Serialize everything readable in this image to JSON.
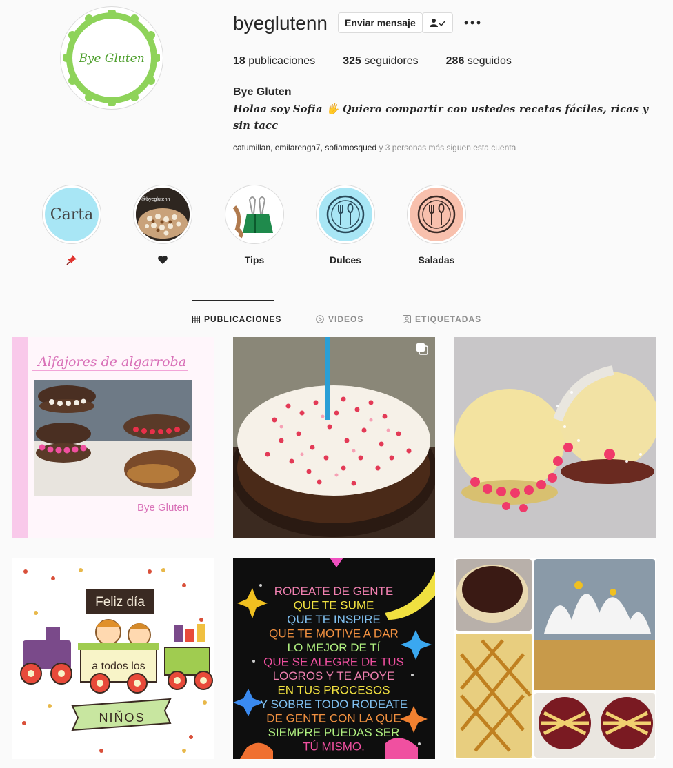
{
  "profile": {
    "username": "byeglutenn",
    "avatar_text": "Bye Gluten",
    "message_button": "Enviar mensaje",
    "follow_icon": "person-check-icon",
    "more_icon": "more-dots-icon",
    "stats": {
      "posts_count": "18",
      "posts_label": "publicaciones",
      "followers_count": "325",
      "followers_label": "seguidores",
      "following_count": "286",
      "following_label": "seguidos"
    },
    "full_name": "Bye Gluten",
    "bio": "Holaa soy Sofia 🖐 Quiero compartir con ustedes recetas fáciles, ricas y sin tacc",
    "followed_by_names": "catumillan, emilarenga7, sofiamosqued",
    "followed_by_more": " y 3 personas más siguen esta cuenta"
  },
  "highlights": [
    {
      "label": "",
      "icon": "pushpin-icon",
      "cover_text": "Carta",
      "cover_color": "#a8e6f5"
    },
    {
      "label": "",
      "icon": "heart-icon",
      "cover_text": "@byeglutenn",
      "cover_color": "#7a5a3d"
    },
    {
      "label": "Tips",
      "icon": "",
      "cover_text": "",
      "cover_color": "#ffffff"
    },
    {
      "label": "Dulces",
      "icon": "",
      "cover_text": "",
      "cover_color": "#a8e6f5"
    },
    {
      "label": "Saladas",
      "icon": "",
      "cover_text": "",
      "cover_color": "#f8c0ad"
    }
  ],
  "tabs": [
    {
      "label": "PUBLICACIONES",
      "icon": "grid-icon",
      "active": true
    },
    {
      "label": "VIDEOS",
      "icon": "play-circle-icon",
      "active": false
    },
    {
      "label": "ETIQUETADAS",
      "icon": "tagged-icon",
      "active": false
    }
  ],
  "posts": [
    {
      "title": "Alfajores de algarroba",
      "footer": "Bye Gluten"
    },
    {
      "multi_icon": "carousel-icon"
    },
    {},
    {
      "banner_top": "Feliz día",
      "banner_mid": "a todos los",
      "banner_bottom": "NIÑOS"
    },
    {
      "quote_lines": [
        "RODEATE DE GENTE",
        "QUE TE SUME",
        "QUE TE INSPIRE",
        "QUE TE MOTIVE A DAR",
        "LO MEJOR DE TÍ",
        "QUE SE ALEGRE DE TUS",
        "LOGROS Y TE APOYE",
        "EN TUS PROCESOS",
        "Y SOBRE TODO RODEATE",
        "DE GENTE CON LA QUE",
        "SIEMPRE PUEDAS SER",
        "TÚ MISMO."
      ]
    },
    {}
  ],
  "colors": {
    "accent_green": "#8ed35a",
    "text": "#262626",
    "muted": "#8e8e8e",
    "border": "#dbdbdb"
  }
}
